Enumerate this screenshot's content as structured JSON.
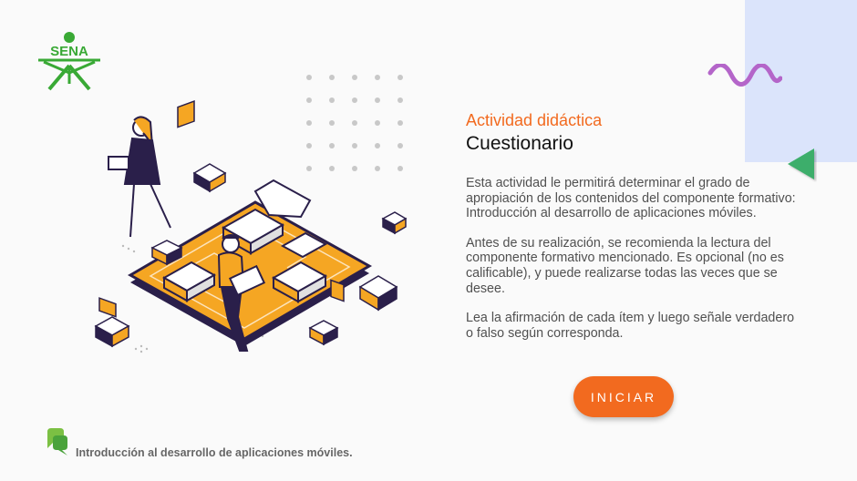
{
  "brand": {
    "logo_text": "SENA",
    "brand_green": "#39a935",
    "accent_orange": "#f26a1f"
  },
  "activity": {
    "subtitle": "Actividad didáctica",
    "title": "Cuestionario",
    "paragraphs": [
      "Esta actividad le permitirá determinar el grado de apropiación de los contenidos del componente formativo: Introducción al desarrollo de aplicaciones móviles.",
      "Antes de su realización, se recomienda la lectura del componente formativo mencionado. Es opcional (no es calificable), y puede realizarse todas las veces que se desee.",
      "Lea la afirmación de cada ítem y luego señale verdadero o falso según corresponda."
    ],
    "start_button": "INICIAR"
  },
  "footer": {
    "course_title": "Introducción al desarrollo de aplicaciones móviles."
  },
  "icons": {
    "logo": "sena-logo-icon",
    "wave": "wave-decoration-icon",
    "triangle": "triangle-decoration-icon",
    "footer": "chat-bubble-icon"
  }
}
